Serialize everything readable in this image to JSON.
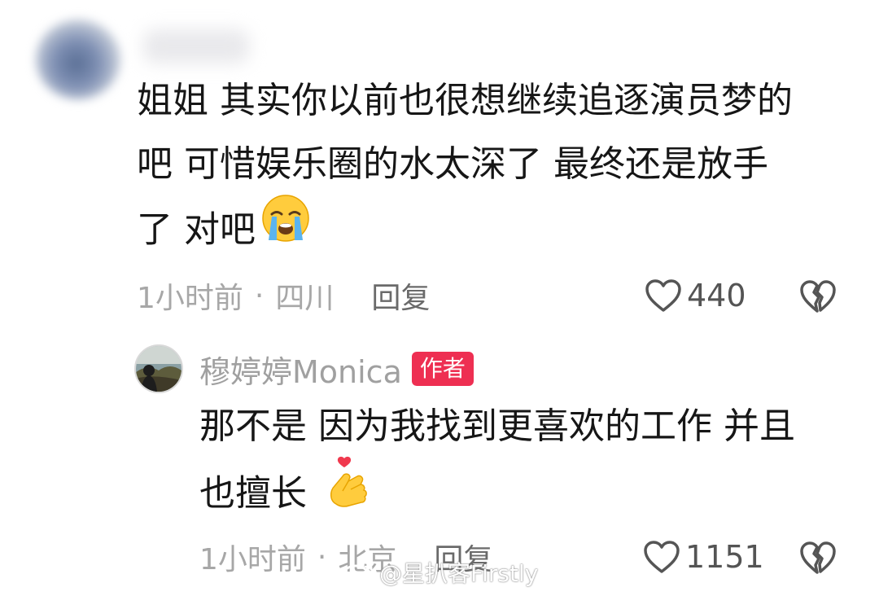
{
  "comment": {
    "avatar_icon": "blurred-user-avatar",
    "text_lines": [
      "姐姐 其实你以前也很想继续追逐演员梦的",
      "吧 可惜娱乐圈的水太深了 最终还是放手",
      "了 对吧"
    ],
    "emoji": "loudly-crying-face-icon",
    "time": "1小时前",
    "separator": "·",
    "location": "四川",
    "reply_label": "回复",
    "likes": "440",
    "like_icon": "heart-outline-icon",
    "dislike_icon": "broken-heart-icon"
  },
  "reply": {
    "avatar_icon": "author-avatar",
    "author_name": "穆婷婷Monica",
    "author_badge": "作者",
    "badge_color": "#ee2f52",
    "text_lines": [
      "那不是 因为我找到更喜欢的工作 并且",
      "也擅长"
    ],
    "emoji": "finger-heart-icon",
    "time": "1小时前",
    "separator": "·",
    "location": "北京",
    "reply_label": "回复",
    "likes": "1151",
    "like_icon": "heart-outline-icon",
    "dislike_icon": "broken-heart-icon"
  },
  "watermark": {
    "icon": "weibo-logo-icon",
    "text": "@星扒客Firstly"
  }
}
